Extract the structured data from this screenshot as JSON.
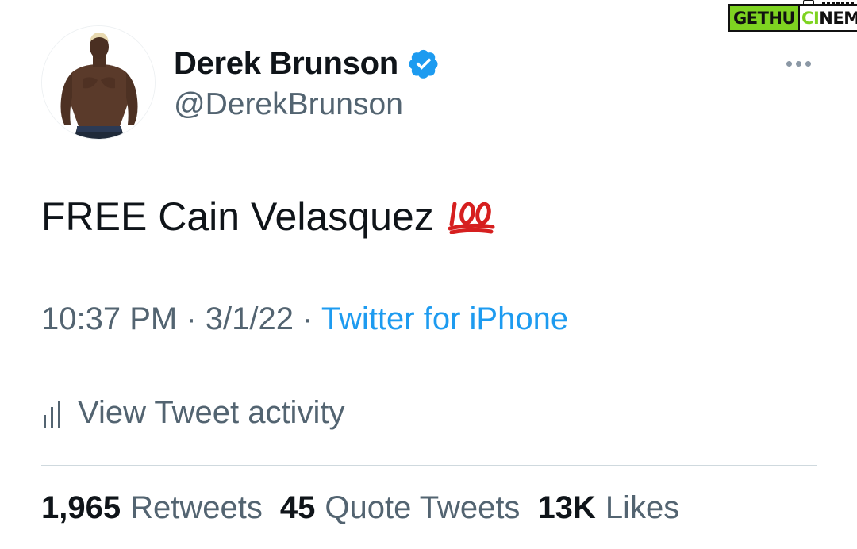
{
  "user": {
    "display_name": "Derek Brunson",
    "handle": "@DerekBrunson",
    "verified": true
  },
  "tweet": {
    "text": "FREE Cain Velasquez",
    "emoji": "hundred-points-icon"
  },
  "meta": {
    "time": "10:37 PM",
    "separator": " · ",
    "date": "3/1/22",
    "source": "Twitter for iPhone"
  },
  "activity": {
    "label": "View Tweet activity"
  },
  "stats": [
    {
      "count": "1,965",
      "label": "Retweets"
    },
    {
      "count": "45",
      "label": "Quote Tweets"
    },
    {
      "count": "13K",
      "label": "Likes"
    }
  ],
  "watermark": {
    "part1": "GETHU",
    "part2_a": "CI",
    "part2_b": "NEMA"
  },
  "colors": {
    "text_primary": "#0f1419",
    "text_secondary": "#536471",
    "accent": "#1d9bf0",
    "divider": "#cfd9de",
    "watermark_green": "#7ed321"
  }
}
